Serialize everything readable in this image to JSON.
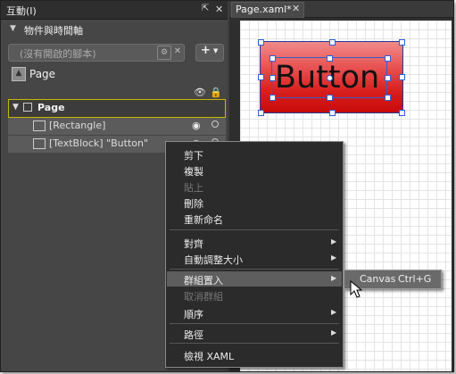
{
  "left_panel": {
    "title": "互動(I)",
    "section_title": "物件與時間軸",
    "script_placeholder": "(沒有開啟的腳本)",
    "add_label": "+",
    "page_top_label": "Page",
    "tree": [
      {
        "label": "Page",
        "type": "root"
      },
      {
        "label": "[Rectangle]",
        "type": "rectangle"
      },
      {
        "label": "[TextBlock] \"Button\"",
        "type": "textblock"
      }
    ]
  },
  "document": {
    "tab_label": "Page.xaml*",
    "button_text": "Button",
    "colors": {
      "button_top": "#f18a8a",
      "button_bottom": "#c80a0a",
      "selection": "#2b5fd8"
    }
  },
  "context_menu": {
    "items": [
      {
        "label": "剪下",
        "enabled": true
      },
      {
        "label": "複製",
        "enabled": true
      },
      {
        "label": "貼上",
        "enabled": false
      },
      {
        "label": "刪除",
        "enabled": true
      },
      {
        "label": "重新命名",
        "enabled": true
      },
      {
        "label": "對齊",
        "enabled": true,
        "submenu": true
      },
      {
        "label": "自動調整大小",
        "enabled": true,
        "submenu": true
      },
      {
        "label": "群組置入",
        "enabled": true,
        "submenu": true,
        "highlighted": true
      },
      {
        "label": "取消群組",
        "enabled": false
      },
      {
        "label": "順序",
        "enabled": true,
        "submenu": true
      },
      {
        "label": "路徑",
        "enabled": true,
        "submenu": true
      },
      {
        "label": "檢視 XAML",
        "enabled": true
      }
    ],
    "submenu": {
      "label": "Canvas",
      "shortcut": "Ctrl+G"
    }
  }
}
